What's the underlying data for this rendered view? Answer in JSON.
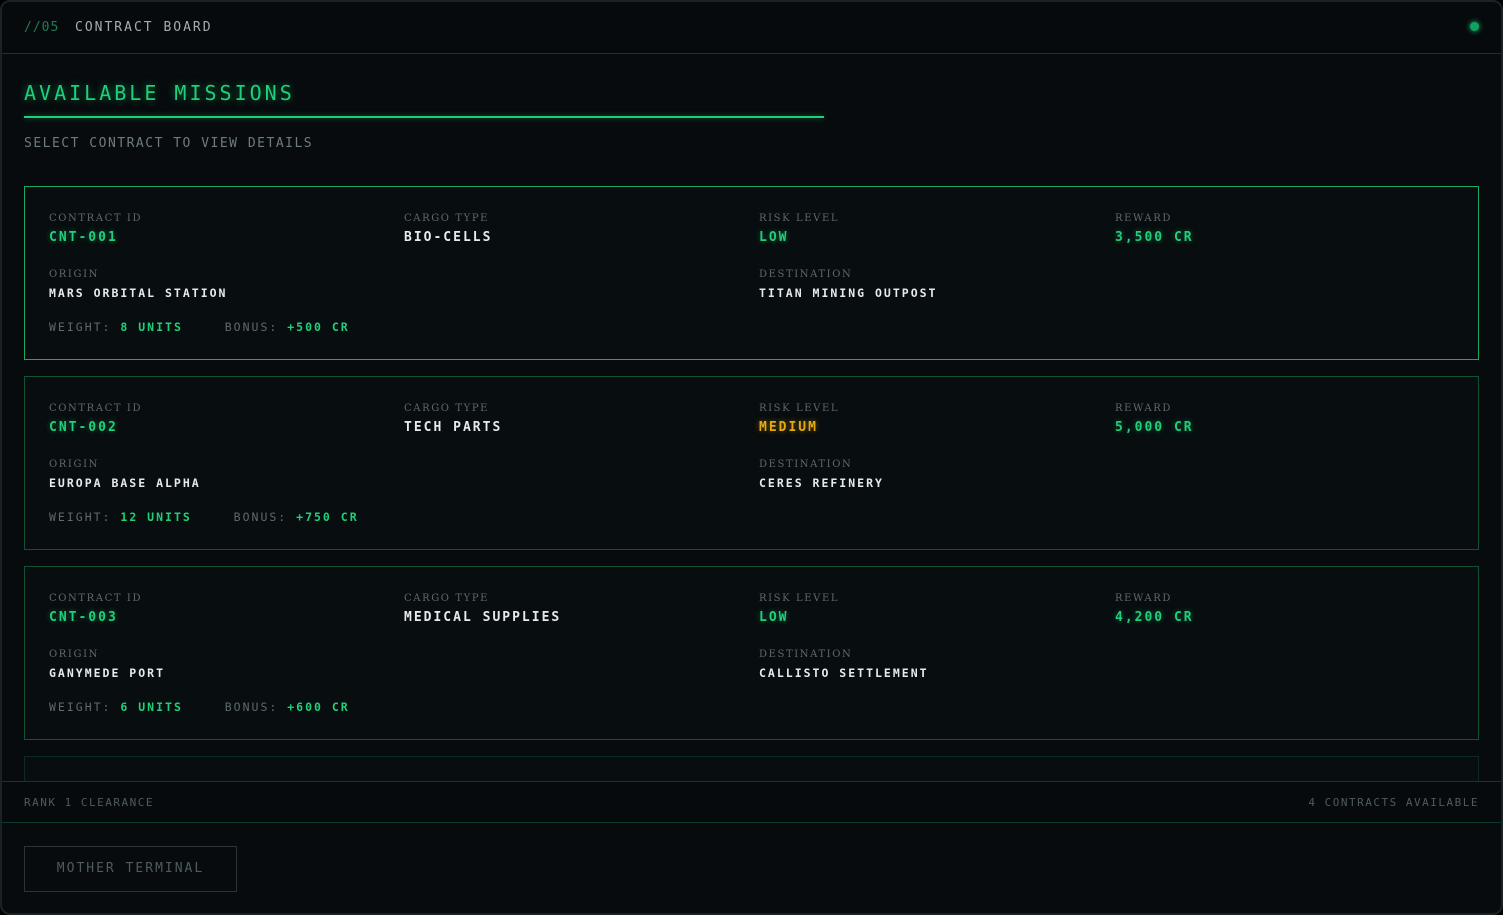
{
  "topbar": {
    "section": "//05",
    "title": "CONTRACT BOARD"
  },
  "main": {
    "heading": "AVAILABLE MISSIONS",
    "subheading": "SELECT CONTRACT TO VIEW DETAILS"
  },
  "labels": {
    "contract_id": "CONTRACT ID",
    "cargo_type": "CARGO TYPE",
    "risk_level": "RISK LEVEL",
    "reward": "REWARD",
    "origin": "ORIGIN",
    "destination": "DESTINATION",
    "weight": "WEIGHT:",
    "bonus": "BONUS:"
  },
  "contracts": [
    {
      "id": "CNT-001",
      "cargo": "BIO-CELLS",
      "risk": "LOW",
      "risk_color": "#1ed07a",
      "reward": "3,500 CR",
      "origin": "MARS ORBITAL STATION",
      "destination": "TITAN MINING OUTPOST",
      "weight": "8 UNITS",
      "bonus": "+500 CR",
      "selected": true
    },
    {
      "id": "CNT-002",
      "cargo": "TECH PARTS",
      "risk": "MEDIUM",
      "risk_color": "#e6a910",
      "reward": "5,000 CR",
      "origin": "EUROPA BASE ALPHA",
      "destination": "CERES REFINERY",
      "weight": "12 UNITS",
      "bonus": "+750 CR",
      "selected": false
    },
    {
      "id": "CNT-003",
      "cargo": "MEDICAL SUPPLIES",
      "risk": "LOW",
      "risk_color": "#1ed07a",
      "reward": "4,200 CR",
      "origin": "GANYMEDE PORT",
      "destination": "CALLISTO SETTLEMENT",
      "weight": "6 UNITS",
      "bonus": "+600 CR",
      "selected": false
    }
  ],
  "footer": {
    "rank": "RANK 1 CLEARANCE",
    "count": "4 CONTRACTS AVAILABLE"
  },
  "bottom_button": "MOTHER TERMINAL",
  "colors": {
    "accent": "#1ed07a",
    "warning": "#e6a910"
  }
}
